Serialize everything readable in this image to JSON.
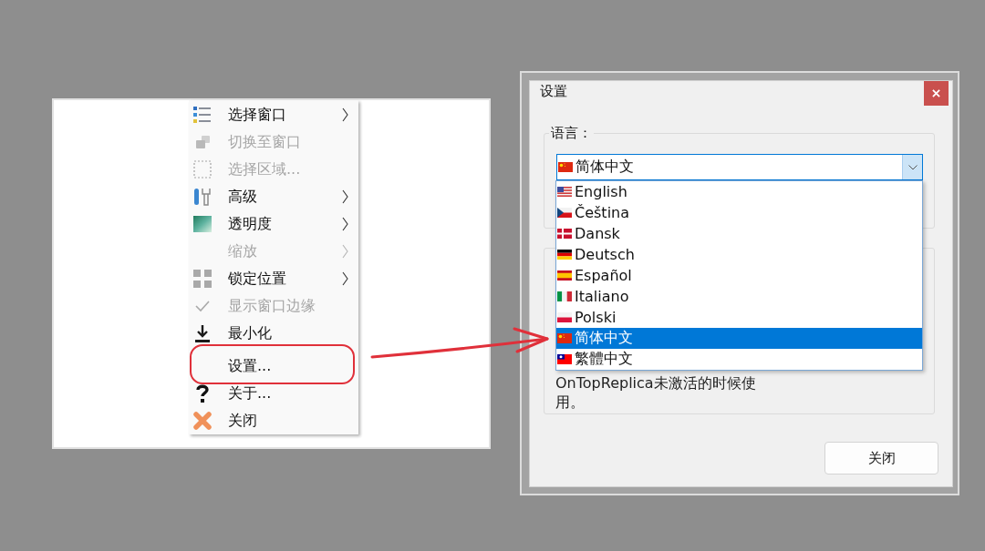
{
  "menu": {
    "sections": [
      {
        "items": [
          {
            "label": "选择窗口",
            "disabled": false,
            "submenu": true,
            "checked": false
          },
          {
            "label": "切换至窗口",
            "disabled": true,
            "submenu": false,
            "checked": false
          },
          {
            "label": "选择区域...",
            "disabled": true,
            "submenu": false,
            "checked": false
          },
          {
            "label": "高级",
            "disabled": false,
            "submenu": true,
            "checked": false
          },
          {
            "label": "透明度",
            "disabled": false,
            "submenu": true,
            "checked": false
          },
          {
            "label": "缩放",
            "disabled": true,
            "submenu": true,
            "checked": false
          },
          {
            "label": "锁定位置",
            "disabled": false,
            "submenu": true,
            "checked": false
          },
          {
            "label": "显示窗口边缘",
            "disabled": true,
            "submenu": false,
            "checked": true
          },
          {
            "label": "最小化",
            "disabled": false,
            "submenu": false,
            "checked": false
          }
        ]
      },
      {
        "items": [
          {
            "label": "设置...",
            "disabled": false,
            "submenu": false,
            "checked": false
          },
          {
            "label": "关于...",
            "disabled": false,
            "submenu": false,
            "checked": false
          },
          {
            "label": "关闭",
            "disabled": false,
            "submenu": false,
            "checked": false
          }
        ]
      }
    ]
  },
  "dialog": {
    "title": "设置",
    "language_group": {
      "label": "语言：",
      "combo": {
        "value": "简体中文",
        "expanded": true
      },
      "options": [
        {
          "label": "English",
          "selected": false
        },
        {
          "label": "Čeština",
          "selected": false
        },
        {
          "label": "Dansk",
          "selected": false
        },
        {
          "label": "Deutsch",
          "selected": false
        },
        {
          "label": "Español",
          "selected": false
        },
        {
          "label": "Italiano",
          "selected": false
        },
        {
          "label": "Polski",
          "selected": false
        },
        {
          "label": "简体中文",
          "selected": true
        },
        {
          "label": "繁體中文",
          "selected": false
        }
      ]
    },
    "note": "OnTopReplica未激活的时候使用。",
    "buttons": [
      "关闭"
    ]
  }
}
